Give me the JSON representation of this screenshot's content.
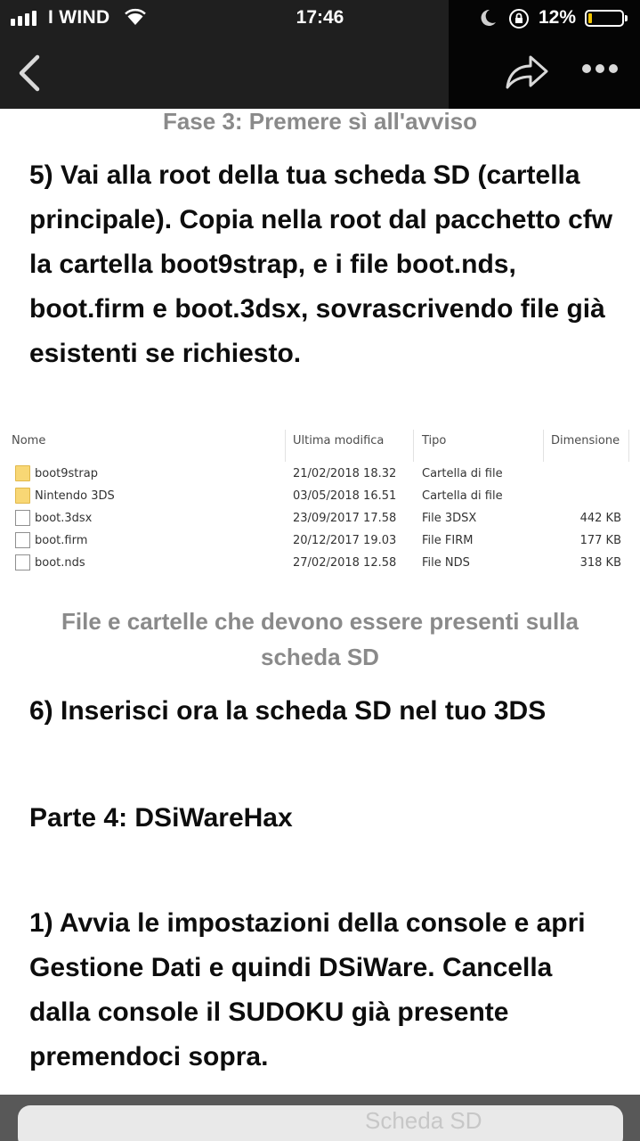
{
  "status_bar": {
    "carrier": "I WIND",
    "time": "17:46",
    "battery_percent": "12%",
    "battery_level": 0.12,
    "signal_bars": 4
  },
  "nav": {
    "back_icon": "chevron-left-icon",
    "share_icon": "share-icon",
    "more_icon": "more-horizontal-icon"
  },
  "content": {
    "caption_top": "Fase 3: Premere sì all'avviso",
    "step5": "5) Vai alla root della tua scheda SD (cartella principale). Copia nella root dal pacchetto cfw la cartella boot9strap, e i file boot.nds, boot.firm e boot.3dsx, sovrascrivendo file già esistenti se richiesto.",
    "file_table": {
      "columns": [
        "Nome",
        "Ultima modifica",
        "Tipo",
        "Dimensione"
      ],
      "rows": [
        {
          "icon": "folder-icon",
          "name": "boot9strap",
          "modified": "21/02/2018 18.32",
          "type": "Cartella di file",
          "size": ""
        },
        {
          "icon": "folder-icon",
          "name": "Nintendo 3DS",
          "modified": "03/05/2018 16.51",
          "type": "Cartella di file",
          "size": ""
        },
        {
          "icon": "file-icon",
          "name": "boot.3dsx",
          "modified": "23/09/2017 17.58",
          "type": "File 3DSX",
          "size": "442 KB"
        },
        {
          "icon": "file-icon",
          "name": "boot.firm",
          "modified": "20/12/2017 19.03",
          "type": "File FIRM",
          "size": "177 KB"
        },
        {
          "icon": "file-icon",
          "name": "boot.nds",
          "modified": "27/02/2018 12.58",
          "type": "File NDS",
          "size": "318 KB"
        }
      ]
    },
    "caption_mid": "File e cartelle che devono essere presenti sulla scheda SD",
    "step6": "6) Inserisci ora la scheda SD nel tuo 3DS",
    "parte4": "Parte 4: DSiWareHax",
    "step1": "1) Avvia le impostazioni della console e apri Gestione Dati e quindi DSiWare. Cancella dalla console il SUDOKU già presente premendoci sopra.",
    "bottom_ghost": "Scheda SD"
  },
  "colors": {
    "topbar": "#1f1f1f",
    "caption_gray": "#8a8a8a",
    "body_text": "#0d0d0d",
    "battery_fill": "#f2c500",
    "folder_yellow": "#f8d775"
  }
}
